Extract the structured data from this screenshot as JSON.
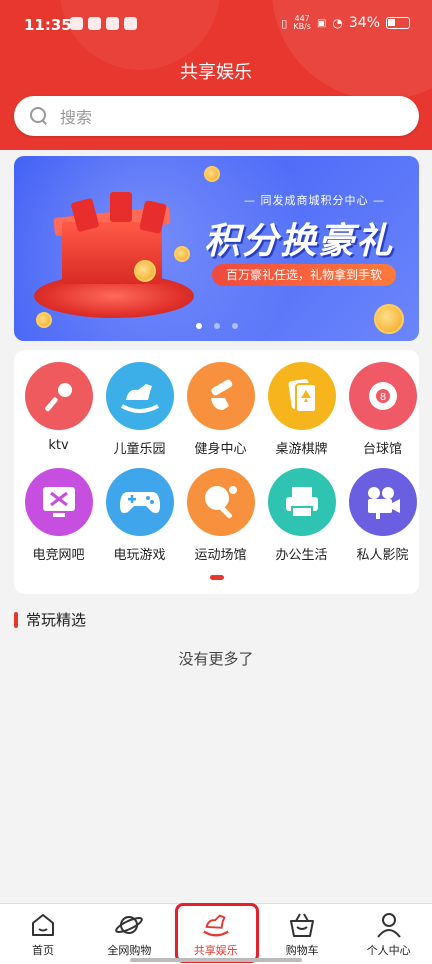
{
  "status": {
    "time": "11:35",
    "speed_top": "447",
    "speed_bottom": "KB/s",
    "battery": "34%"
  },
  "page_title": "共享娱乐",
  "search": {
    "placeholder": "搜索"
  },
  "banner": {
    "subtitle": "— 同发成商城积分中心 —",
    "headline": "积分换豪礼",
    "tag": "百万豪礼任选，礼物拿到手软"
  },
  "categories": [
    {
      "label": "ktv",
      "icon": "microphone-icon",
      "color": "#ef5a5f"
    },
    {
      "label": "儿童乐园",
      "icon": "rocking-horse-icon",
      "color": "#3dafe8"
    },
    {
      "label": "健身中心",
      "icon": "dumbbell-icon",
      "color": "#f7913d"
    },
    {
      "label": "桌游棋牌",
      "icon": "playing-cards-icon",
      "color": "#f6b51c"
    },
    {
      "label": "台球馆",
      "icon": "billiard-ball-icon",
      "color": "#f05a67"
    },
    {
      "label": "电竞网吧",
      "icon": "esports-monitor-icon",
      "color": "#c74fe0"
    },
    {
      "label": "电玩游戏",
      "icon": "gamepad-icon",
      "color": "#3fa6ec"
    },
    {
      "label": "运动场馆",
      "icon": "ping-pong-icon",
      "color": "#f7913d"
    },
    {
      "label": "办公生活",
      "icon": "printer-icon",
      "color": "#2fc4b2"
    },
    {
      "label": "私人影院",
      "icon": "movie-camera-icon",
      "color": "#6a5fe0"
    }
  ],
  "section_title": "常玩精选",
  "empty_text": "没有更多了",
  "tabs": [
    {
      "label": "首页",
      "icon": "home-icon"
    },
    {
      "label": "全网购物",
      "icon": "planet-icon"
    },
    {
      "label": "共享娱乐",
      "icon": "rocking-horse-icon",
      "active": true
    },
    {
      "label": "购物车",
      "icon": "basket-icon"
    },
    {
      "label": "个人中心",
      "icon": "user-icon"
    }
  ],
  "colors": {
    "brand": "#e8372f",
    "banner": "#4f6cf8"
  }
}
